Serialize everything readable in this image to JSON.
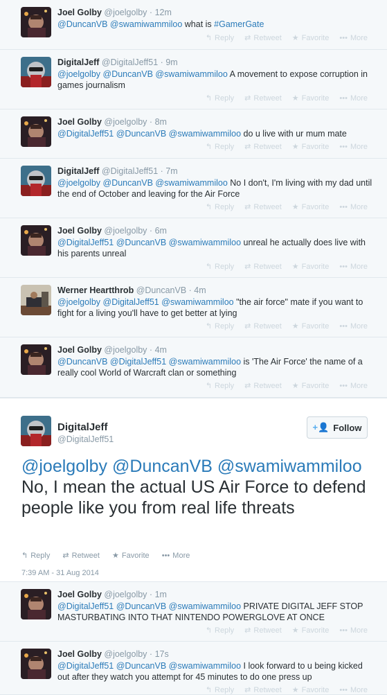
{
  "tweets_above": [
    {
      "name": "Joel Golby",
      "handle": "@joelgolby",
      "sep": "·",
      "time": "12m",
      "mentions": "@DuncanVB @swamiwammiloo",
      "body": "what is",
      "hashtag": "#GamerGate",
      "avatar": "joel"
    },
    {
      "name": "DigitalJeff",
      "handle": "@DigitalJeff51",
      "sep": "·",
      "time": "9m",
      "mentions": "@joelgolby @DuncanVB @swamiwammiloo",
      "body": "A movement to expose corruption in games journalism",
      "avatar": "jeff"
    },
    {
      "name": "Joel Golby",
      "handle": "@joelgolby",
      "sep": "·",
      "time": "8m",
      "mentions": "@DigitalJeff51 @DuncanVB @swamiwammiloo",
      "body": "do u live with ur mum mate",
      "avatar": "joel"
    },
    {
      "name": "DigitalJeff",
      "handle": "@DigitalJeff51",
      "sep": "·",
      "time": "7m",
      "mentions": "@joelgolby @DuncanVB @swamiwammiloo",
      "body": "No I don't, I'm living with my dad until the end of October and leaving for the Air Force",
      "avatar": "jeff"
    },
    {
      "name": "Joel Golby",
      "handle": "@joelgolby",
      "sep": "·",
      "time": "6m",
      "mentions": "@DigitalJeff51 @DuncanVB @swamiwammiloo",
      "body": "unreal he actually does live with his parents unreal",
      "avatar": "joel"
    },
    {
      "name": "Werner Heartthrob",
      "handle": "@DuncanVB",
      "sep": "·",
      "time": "4m",
      "mentions": "@joelgolby @DigitalJeff51 @swamiwammiloo",
      "body": "\"the air force\" mate if you want to fight for a living you'll have to get better at lying",
      "avatar": "werner"
    },
    {
      "name": "Joel Golby",
      "handle": "@joelgolby",
      "sep": "·",
      "time": "4m",
      "mentions": "@DuncanVB @DigitalJeff51 @swamiwammiloo",
      "body": "is 'The Air Force' the name of a really cool World of Warcraft clan or something",
      "avatar": "joel"
    }
  ],
  "tweets_below": [
    {
      "name": "Joel Golby",
      "handle": "@joelgolby",
      "sep": "·",
      "time": "1m",
      "mentions": "@DigitalJeff51 @DuncanVB @swamiwammiloo",
      "body": "PRIVATE DIGITAL JEFF STOP MASTURBATING INTO THAT NINTENDO POWERGLOVE AT ONCE",
      "avatar": "joel"
    },
    {
      "name": "Joel Golby",
      "handle": "@joelgolby",
      "sep": "·",
      "time": "17s",
      "mentions": "@DigitalJeff51 @DuncanVB @swamiwammiloo",
      "body": "I look forward to u being kicked out after they watch you attempt for 45 minutes to do one press up",
      "avatar": "joel"
    }
  ],
  "actions": {
    "reply": "Reply",
    "retweet": "Retweet",
    "favorite": "Favorite",
    "more": "More"
  },
  "icons": {
    "reply": "reply-arrow-icon",
    "retweet": "retweet-icon",
    "favorite": "star-icon",
    "more": "more-dots-icon",
    "follow": "add-user-icon"
  },
  "focused": {
    "name": "DigitalJeff",
    "handle": "@DigitalJeff51",
    "follow_label": "Follow",
    "mentions1": "@joelgolby @DuncanVB",
    "mentions2": "@swamiwammiloo",
    "body": "No, I mean the actual US Air Force to defend people like you from real life threats",
    "date": "7:39 AM - 31 Aug 2014"
  },
  "colors": {
    "link": "#2b7bb9",
    "muted": "#8899a6",
    "action_inactive": "#ccd6dd",
    "follow_icon": "#55acee"
  }
}
